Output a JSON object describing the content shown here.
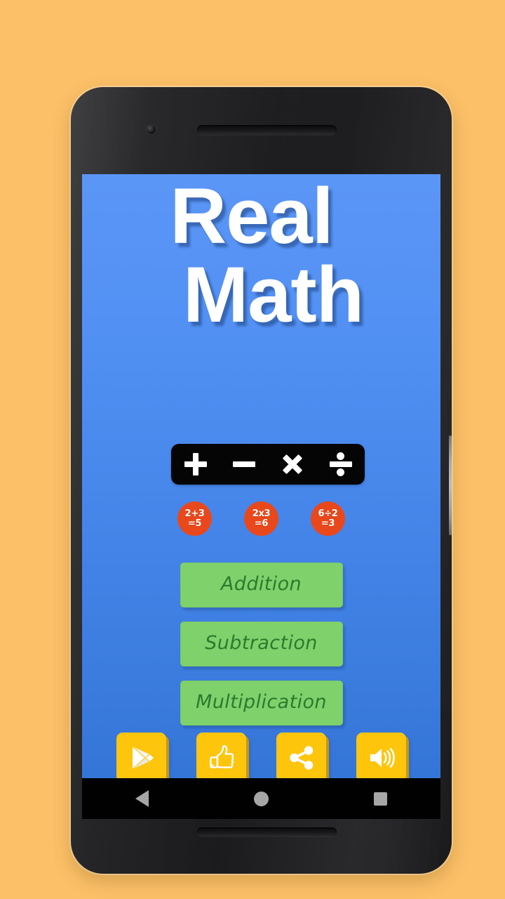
{
  "page": {
    "background_color": "#fbc068",
    "device_frame_color": "#1e1e20"
  },
  "device": {
    "front_camera": "front-camera",
    "earpiece": "earpiece-speaker",
    "bottom_speaker": "bottom-speaker",
    "power_button": "power-button"
  },
  "screen": {
    "background_top_color": "#5b96f6",
    "background_bottom_color": "#3173d4"
  },
  "app": {
    "title_line_1": "Real",
    "title_line_2": "Math",
    "title_color": "#ffffff",
    "operator_strip": {
      "background_color": "#050505",
      "symbols": [
        {
          "name": "plus",
          "label": "+"
        },
        {
          "name": "minus",
          "label": "−"
        },
        {
          "name": "multiply",
          "label": "×"
        },
        {
          "name": "divide",
          "label": "÷"
        }
      ]
    },
    "examples": {
      "bubble_color": "#e8481b",
      "items": [
        {
          "expression": "2+3",
          "result": "=5"
        },
        {
          "expression": "2x3",
          "result": "=6"
        },
        {
          "expression": "6÷2",
          "result": "=3"
        }
      ]
    },
    "menu": {
      "button_color": "#7fd16c",
      "button_text_color": "#2c7a2c",
      "items": [
        {
          "label": "Addition"
        },
        {
          "label": "Subtraction"
        },
        {
          "label": "Multiplication"
        }
      ]
    },
    "footer": {
      "tile_color": "#fec50d",
      "items": [
        {
          "name": "google-play-icon",
          "label": "Rate on Google Play"
        },
        {
          "name": "thumbs-up-icon",
          "label": "Like"
        },
        {
          "name": "share-icon",
          "label": "Share"
        },
        {
          "name": "sound-icon",
          "label": "Sound"
        }
      ]
    }
  },
  "android_nav": {
    "back": "back",
    "home": "home",
    "recents": "recents"
  }
}
